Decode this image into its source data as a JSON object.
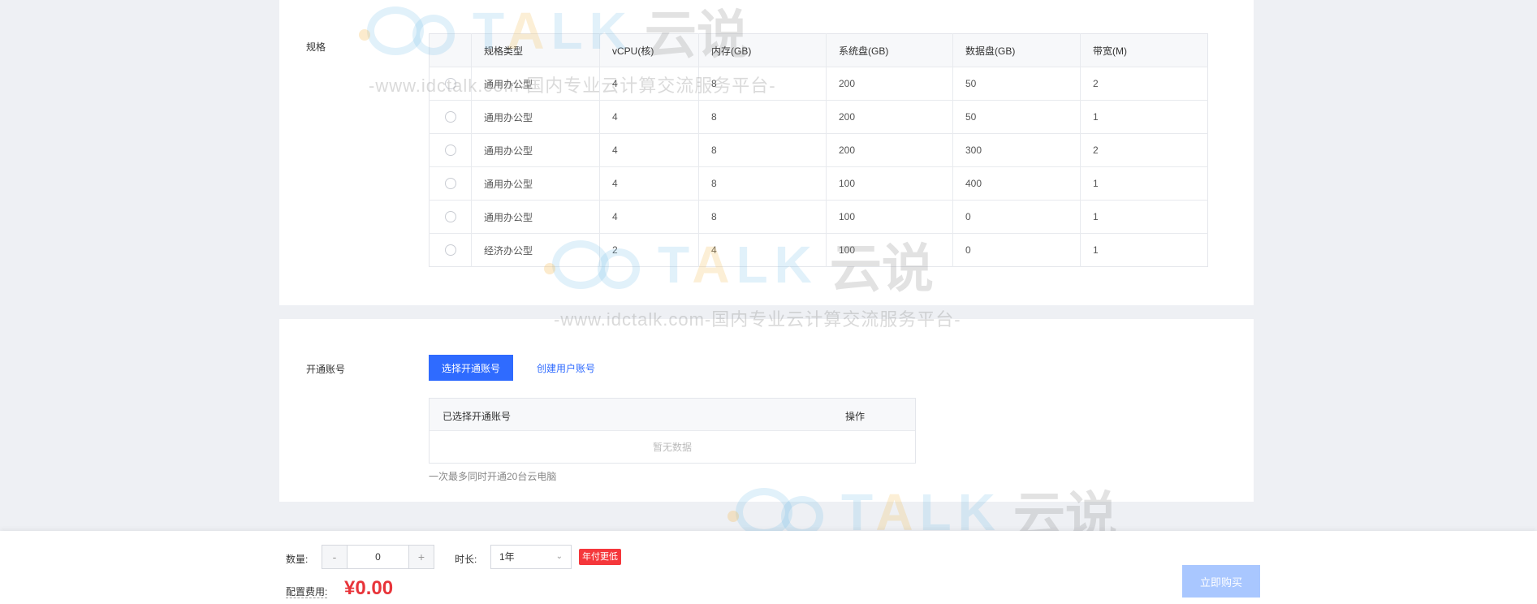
{
  "spec_section": {
    "label": "规格",
    "columns": [
      "规格类型",
      "vCPU(核)",
      "内存(GB)",
      "系统盘(GB)",
      "数据盘(GB)",
      "带宽(M)"
    ],
    "rows": [
      [
        "通用办公型",
        "4",
        "8",
        "200",
        "50",
        "2"
      ],
      [
        "通用办公型",
        "4",
        "8",
        "200",
        "50",
        "1"
      ],
      [
        "通用办公型",
        "4",
        "8",
        "200",
        "300",
        "2"
      ],
      [
        "通用办公型",
        "4",
        "8",
        "100",
        "400",
        "1"
      ],
      [
        "通用办公型",
        "4",
        "8",
        "100",
        "0",
        "1"
      ],
      [
        "经济办公型",
        "2",
        "4",
        "100",
        "0",
        "1"
      ]
    ]
  },
  "account_section": {
    "label": "开通账号",
    "select_button": "选择开通账号",
    "create_link": "创建用户账号",
    "table_headers": [
      "已选择开通账号",
      "操作"
    ],
    "empty_text": "暂无数据",
    "note": "一次最多同时开通20台云电脑"
  },
  "footer": {
    "quantity_label": "数量:",
    "quantity_minus": "-",
    "quantity_value": "0",
    "quantity_plus": "+",
    "duration_label": "时长:",
    "duration_value": "1年",
    "duration_badge": "年付更低",
    "fee_label": "配置费用:",
    "price": "¥0.00",
    "buy_button": "立即购买"
  },
  "watermark": {
    "brand_prefix": "T",
    "brand_a": "A",
    "brand_suffix": "LK",
    "brand_cn": "云说",
    "url_text": "-www.idctalk.com-国内专业云计算交流服务平台-"
  },
  "colors": {
    "primary": "#2f6bff",
    "price_red": "#e8343a",
    "badge_red": "#f5373b",
    "buy_disabled": "#a9c7ff"
  }
}
